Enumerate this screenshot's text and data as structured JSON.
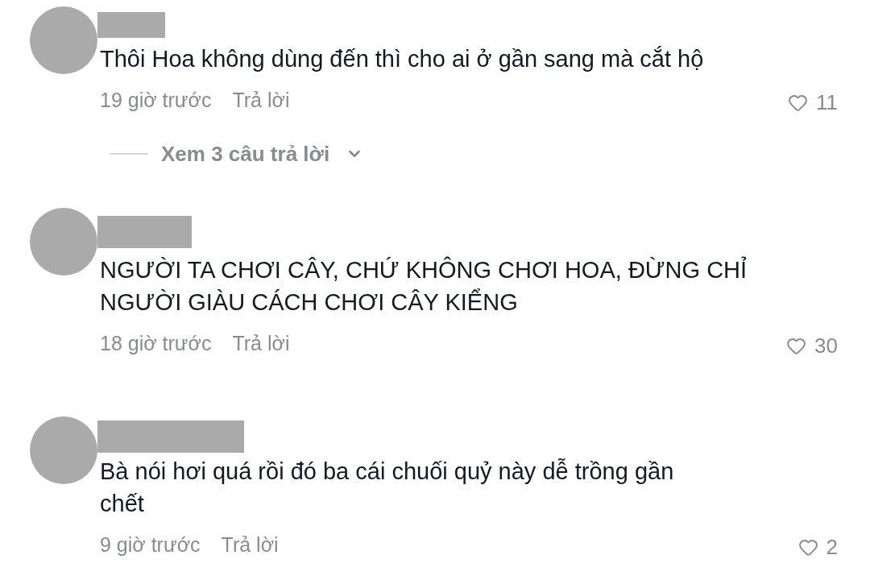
{
  "comments": [
    {
      "text": "Thôi Hoa không dùng đến thì cho ai ở gần sang mà cắt hộ",
      "time": "19 giờ trước",
      "reply_label": "Trả lời",
      "likes": "11",
      "replies": {
        "label": "Xem 3 câu trả lời",
        "expanded": false
      }
    },
    {
      "text": "NGƯỜI TA CHƠI CÂY, CHỨ KHÔNG CHƠI HOA, ĐỪNG CHỈ NGƯỜI GIÀU CÁCH CHƠI CÂY KIỂNG",
      "time": "18 giờ trước",
      "reply_label": "Trả lời",
      "likes": "30"
    },
    {
      "text": "Bà nói hơi quá rồi đó ba cái chuối quỷ này dễ trồng gần chết",
      "time": "9 giờ trước",
      "reply_label": "Trả lời",
      "likes": "2"
    }
  ]
}
